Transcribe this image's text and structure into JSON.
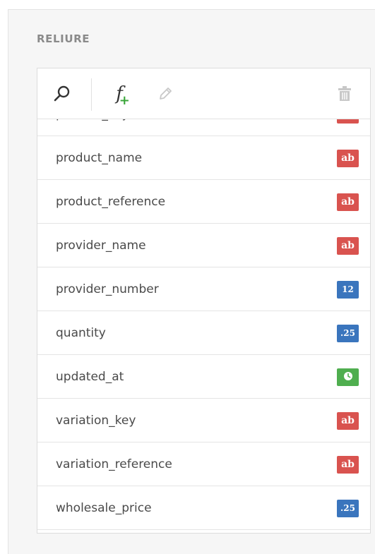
{
  "section": {
    "title": "RELIURE"
  },
  "toolbar": {
    "search_icon": "search-icon",
    "formula_icon": "add-formula-icon",
    "formula_glyph": "f",
    "formula_plus": "+",
    "edit_icon": "pencil-icon",
    "delete_icon": "trash-icon"
  },
  "colors": {
    "text_type": "#d9534f",
    "number_type": "#3a75bd",
    "date_type": "#4fae4f",
    "formula_plus": "#3aa63a"
  },
  "fields": [
    {
      "name": "product_key",
      "type": "text",
      "badge": "ab"
    },
    {
      "name": "product_name",
      "type": "text",
      "badge": "ab"
    },
    {
      "name": "product_reference",
      "type": "text",
      "badge": "ab"
    },
    {
      "name": "provider_name",
      "type": "text",
      "badge": "ab"
    },
    {
      "name": "provider_number",
      "type": "integer",
      "badge": "12"
    },
    {
      "name": "quantity",
      "type": "decimal",
      "badge": ".25"
    },
    {
      "name": "updated_at",
      "type": "date",
      "badge": ""
    },
    {
      "name": "variation_key",
      "type": "text",
      "badge": "ab"
    },
    {
      "name": "variation_reference",
      "type": "text",
      "badge": "ab"
    },
    {
      "name": "wholesale_price",
      "type": "decimal",
      "badge": ".25"
    }
  ]
}
